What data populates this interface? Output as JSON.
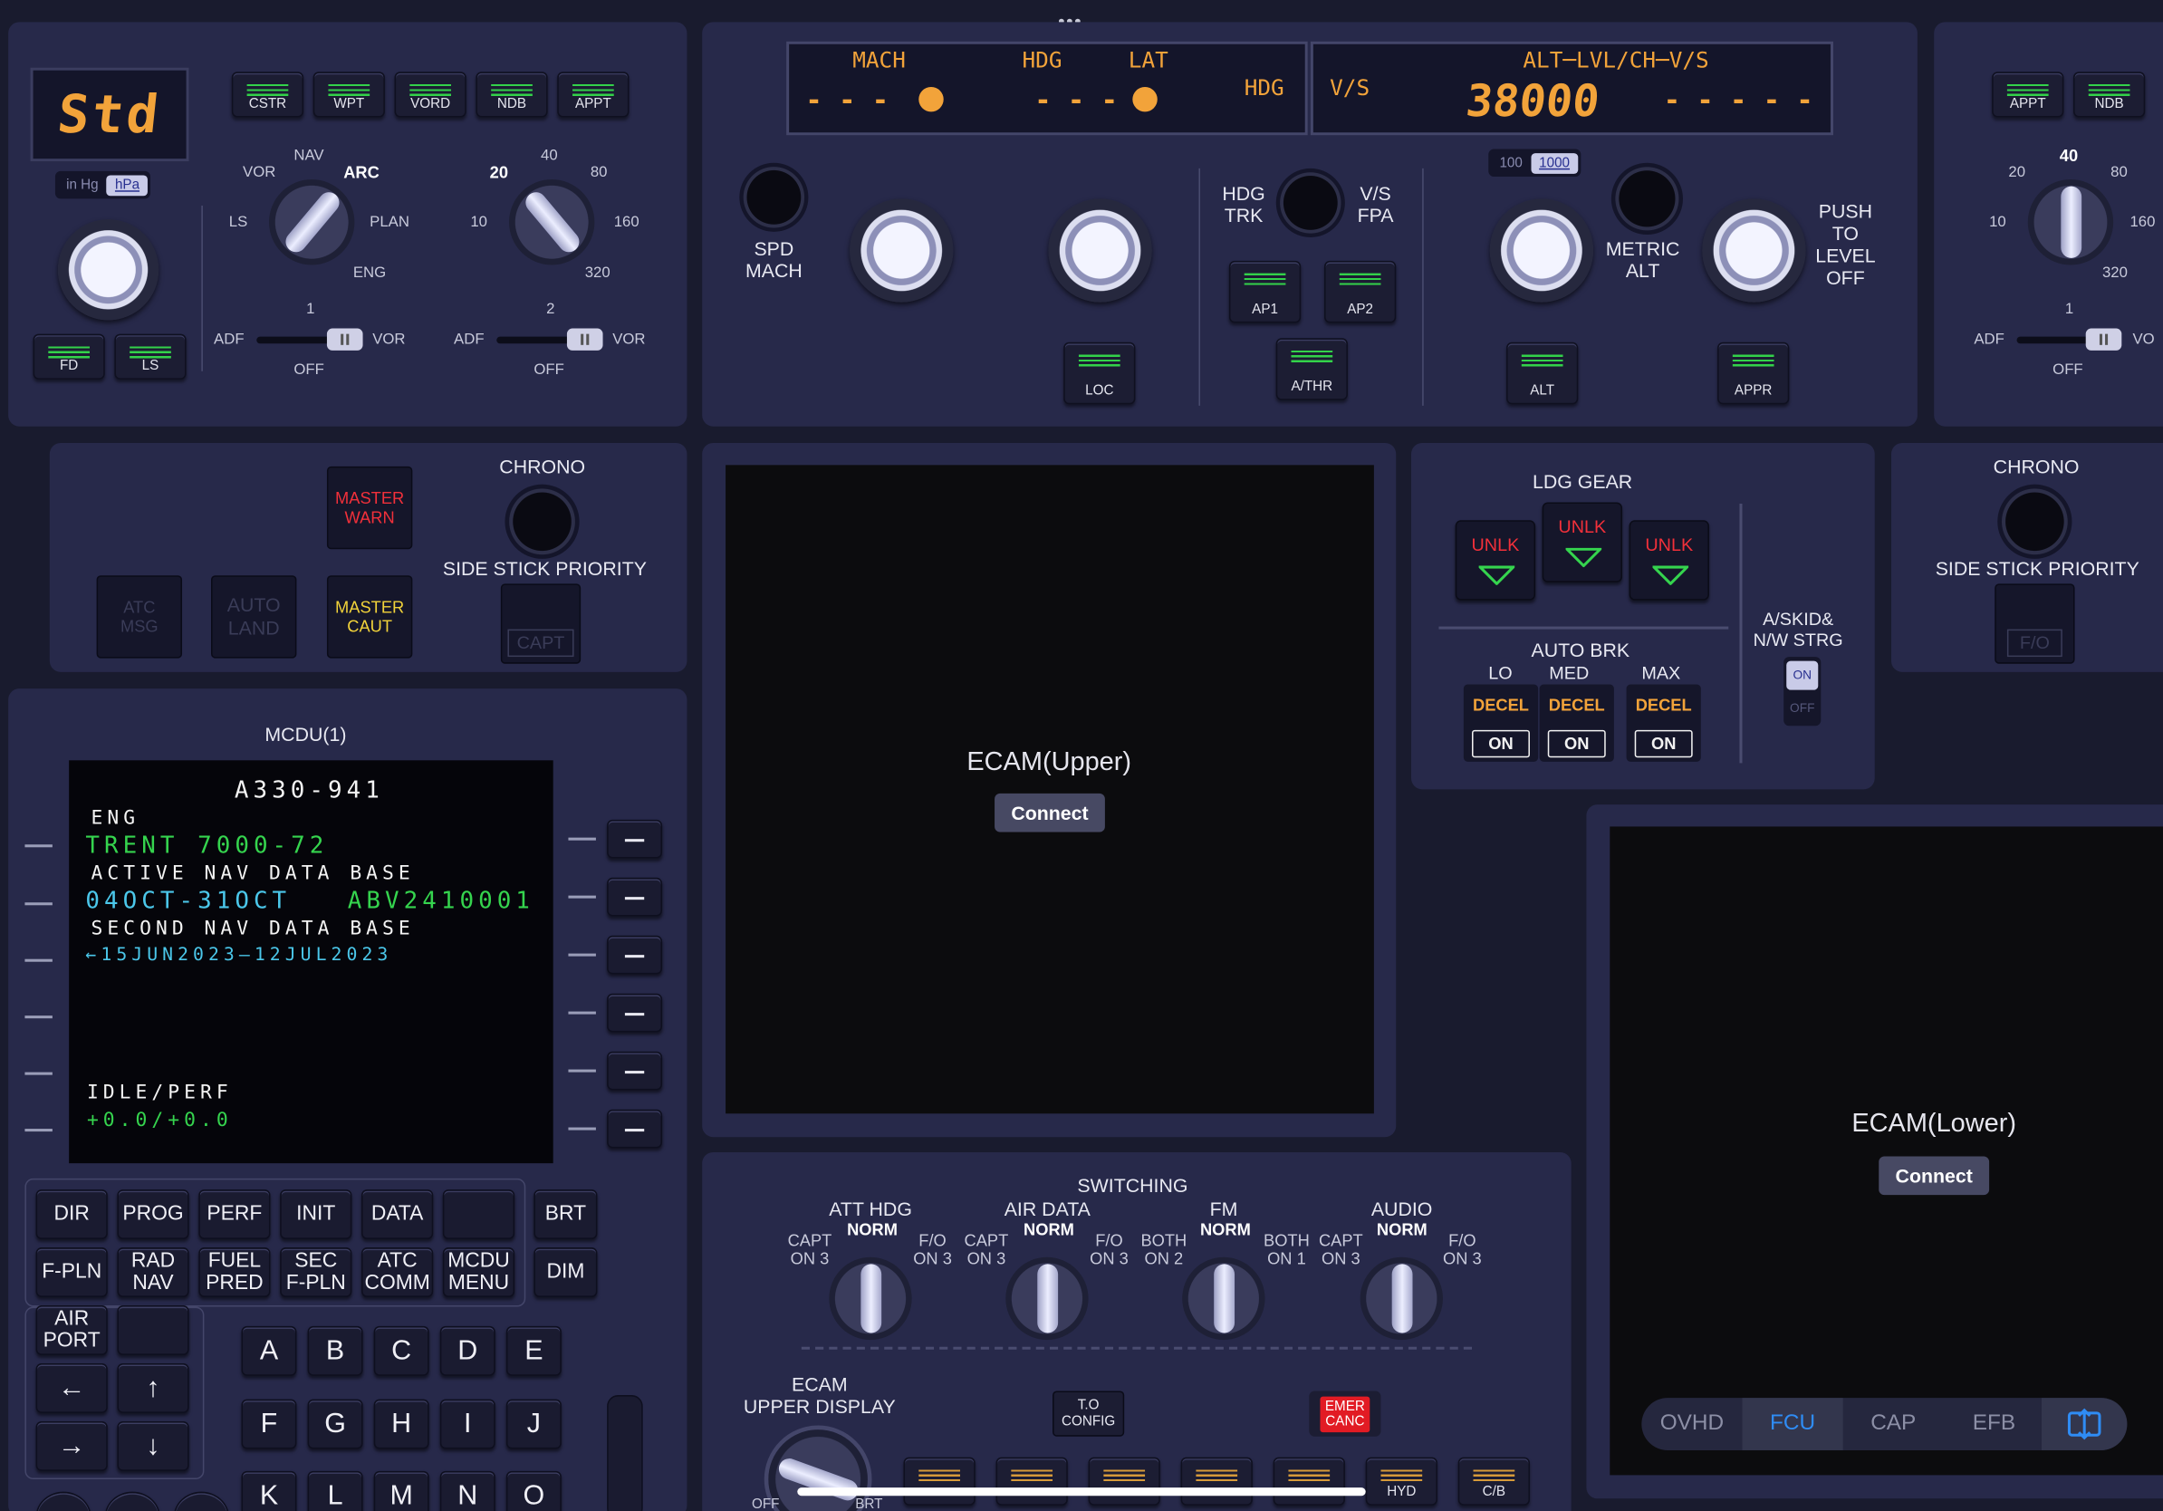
{
  "app": {
    "drag_handle": "•••"
  },
  "efis_left": {
    "baro_display": "Std",
    "baro_toggle": [
      "in Hg",
      "hPa"
    ],
    "buttons": [
      "CSTR",
      "WPT",
      "VORD",
      "NDB",
      "APPT"
    ],
    "bottom_buttons": [
      "FD",
      "LS"
    ],
    "mode_labels": {
      "nav": "NAV",
      "vor": "VOR",
      "arc": "ARC",
      "ls": "LS",
      "plan": "PLAN",
      "eng": "ENG"
    },
    "range_labels": {
      "r10": "10",
      "r20": "20",
      "r40": "40",
      "r80": "80",
      "r160": "160",
      "r320": "320"
    },
    "adf1": {
      "num": "1",
      "adf": "ADF",
      "vor": "VOR",
      "off": "OFF"
    },
    "adf2": {
      "num": "2",
      "adf": "ADF",
      "vor": "VOR",
      "off": "OFF"
    }
  },
  "fcu": {
    "mach_label": "MACH",
    "mach_value": "- - -",
    "hdg_label": "HDG",
    "lat_label": "LAT",
    "hdg_value": "- - -",
    "hdg_mode": "HDG",
    "vs_label": "V/S",
    "alt_header": "ALT─LVL/CH─V/S",
    "alt_value": "38000",
    "vs_value": "- - - - -",
    "spd_mach": "SPD\nMACH",
    "hdg_trk": "HDG\nTRK",
    "vs_fpa": "V/S\nFPA",
    "ap_buttons": [
      "AP1",
      "AP2"
    ],
    "athr": "A/THR",
    "loc": "LOC",
    "alt_toggle": [
      "100",
      "1000"
    ],
    "metric_alt": "METRIC\nALT",
    "push_level_off": "PUSH\nTO\nLEVEL\nOFF",
    "alt_btn": "ALT",
    "appr_btn": "APPR"
  },
  "efis_right": {
    "buttons": [
      "APPT",
      "NDB"
    ],
    "range_labels": {
      "r10": "10",
      "r20": "20",
      "r40": "40",
      "r80": "80",
      "r160": "160",
      "r320": "320"
    },
    "adf1": {
      "num": "1",
      "adf": "ADF",
      "vor": "VO",
      "off": "OFF"
    }
  },
  "glare_left": {
    "master_warn": "MASTER\nWARN",
    "master_caut": "MASTER\nCAUT",
    "atc_msg": "ATC\nMSG",
    "auto_land": "AUTO\nLAND",
    "chrono": "CHRONO",
    "side_stick": "SIDE STICK PRIORITY",
    "capt": "CAPT"
  },
  "glare_right": {
    "chrono": "CHRONO",
    "side_stick": "SIDE STICK PRIORITY",
    "fo": "F/O"
  },
  "ecam_upper": {
    "title": "ECAM(Upper)",
    "connect": "Connect"
  },
  "ecam_lower": {
    "title": "ECAM(Lower)",
    "connect": "Connect"
  },
  "ldg_gear": {
    "title": "LDG GEAR",
    "unlk": [
      "UNLK",
      "UNLK",
      "UNLK"
    ],
    "auto_brk": "AUTO BRK",
    "levels": [
      "LO",
      "MED",
      "MAX"
    ],
    "decel": [
      "DECEL",
      "DECEL",
      "DECEL"
    ],
    "on": [
      "ON",
      "ON",
      "ON"
    ],
    "askid": "A/SKID&\nN/W STRG",
    "askid_on": "ON",
    "askid_off": "OFF"
  },
  "mcdu": {
    "title": "MCDU(1)",
    "lines": [
      {
        "text": "A330-941",
        "color": "wt"
      },
      {
        "text": " ENG",
        "color": "wt"
      },
      {
        "text": "TRENT 7000-72",
        "color": "gr"
      },
      {
        "text": " ACTIVE NAV DATA BASE",
        "color": "wt"
      },
      {
        "text": "04OCT-31OCT",
        "color": "cy"
      },
      {
        "text": "ABV2410001",
        "color": "gr"
      },
      {
        "text": " SECOND NAV DATA BASE",
        "color": "wt"
      },
      {
        "text": "←15JUN2023‒12JUL2023",
        "color": "cy"
      },
      {
        "text": "IDLE/PERF",
        "color": "wt"
      },
      {
        "text": "+0.0/+0.0",
        "color": "gr"
      }
    ],
    "func_keys": [
      "DIR",
      "PROG",
      "PERF",
      "INIT",
      "DATA",
      "",
      "F-PLN",
      "RAD\nNAV",
      "FUEL\nPRED",
      "SEC\nF-PLN",
      "ATC\nCOMM",
      "MCDU\nMENU"
    ],
    "brt": "BRT",
    "dim": "DIM",
    "airport": "AIR\nPORT",
    "arrows": [
      "←",
      "↑",
      "→",
      "↓"
    ],
    "letters": [
      "A",
      "B",
      "C",
      "D",
      "E",
      "F",
      "G",
      "H",
      "I",
      "J",
      "K",
      "L",
      "M",
      "N",
      "O"
    ]
  },
  "switching": {
    "title": "SWITCHING",
    "knobs": [
      {
        "name": "ATT HDG",
        "norm": "NORM",
        "left": "CAPT\nON 3",
        "right": "F/O\nON 3"
      },
      {
        "name": "AIR DATA",
        "norm": "NORM",
        "left": "CAPT\nON 3",
        "right": "F/O\nON 3"
      },
      {
        "name": "FM",
        "norm": "NORM",
        "left": "BOTH\nON 2",
        "right": "BOTH\nON 1"
      },
      {
        "name": "AUDIO",
        "norm": "NORM",
        "left": "CAPT\nON 3",
        "right": "F/O\nON 3"
      }
    ],
    "ecam_upper_display": "ECAM\nUPPER DISPLAY",
    "off": "OFF",
    "brt": "BRT",
    "to_config": "T.O\nCONFIG",
    "emer_canc": "EMER\nCANC",
    "bottom_buttons": [
      "",
      "",
      "",
      "",
      "",
      "HYD",
      "C/B"
    ]
  },
  "nav_tabs": [
    "OVHD",
    "FCU",
    "CAP",
    "EFB"
  ],
  "colors": {
    "amber": "#f2a33a",
    "green": "#35d44e",
    "cyan": "#4bc7ea",
    "red": "#f2303a",
    "accent_blue": "#2f8cf4"
  }
}
